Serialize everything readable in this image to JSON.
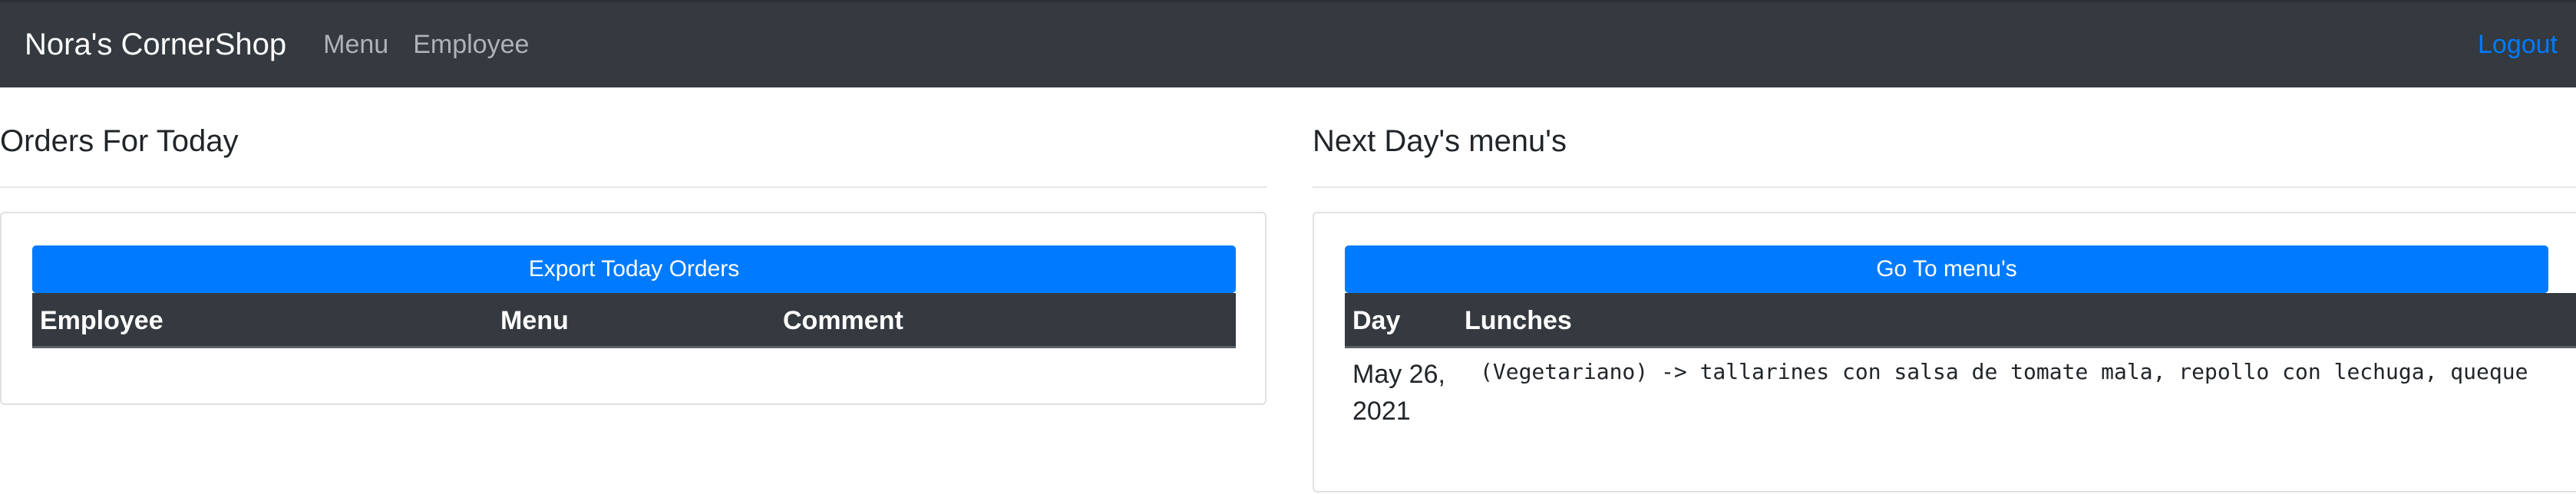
{
  "navbar": {
    "brand": "Nora's CornerShop",
    "links": [
      "Menu",
      "Employee"
    ],
    "logout": "Logout"
  },
  "orders": {
    "title": "Orders For Today",
    "export_button": "Export Today Orders",
    "columns": [
      "Employee",
      "Menu",
      "Comment"
    ],
    "rows": []
  },
  "menus": {
    "title": "Next Day's menu's",
    "goto_button": "Go To menu's",
    "columns": [
      "Day",
      "Lunches"
    ],
    "rows": [
      {
        "day_line1": "May 26,",
        "day_line2": "2021",
        "lunches": "(Vegetariano) -> tallarines con salsa de tomate mala, repollo con lechuga, queque"
      }
    ]
  },
  "colors": {
    "navbar_bg": "#343a40",
    "primary": "#007bff",
    "table_header_bg": "#343a40"
  }
}
